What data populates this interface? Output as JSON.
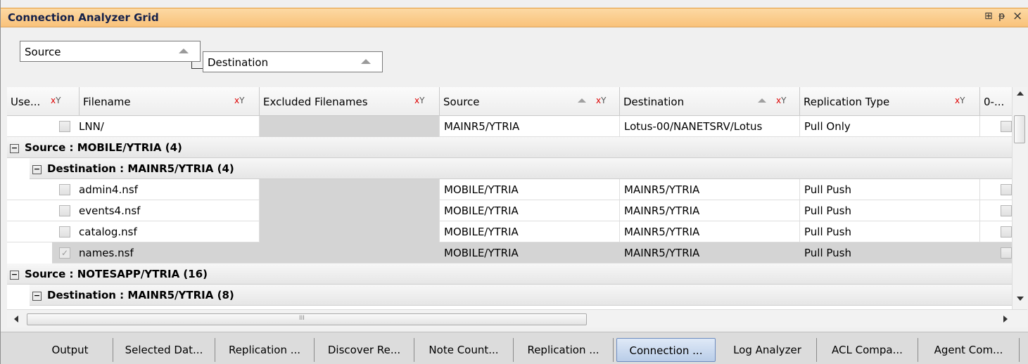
{
  "window": {
    "title": "Connection Analyzer Grid",
    "controls": {
      "pin": "⊞",
      "dock": "ᵽ",
      "close": "×"
    }
  },
  "group_by": {
    "level1": "Source",
    "level2": "Destination"
  },
  "columns": {
    "use": "Use...",
    "filename": "Filename",
    "excluded": "Excluded Filenames",
    "source": "Source",
    "destination": "Destination",
    "replication_type": "Replication Type",
    "extra": "0-..."
  },
  "rows": {
    "top": {
      "filename": "LNN/",
      "source": "MAINR5/YTRIA",
      "destination": "Lotus-00/NANETSRV/Lotus",
      "type": "Pull Only"
    },
    "group1": "Source : MOBILE/YTRIA (4)",
    "group1_sub": "Destination : MAINR5/YTRIA (4)",
    "r1": {
      "filename": "admin4.nsf",
      "source": "MOBILE/YTRIA",
      "destination": "MAINR5/YTRIA",
      "type": "Pull Push"
    },
    "r2": {
      "filename": "events4.nsf",
      "source": "MOBILE/YTRIA",
      "destination": "MAINR5/YTRIA",
      "type": "Pull Push"
    },
    "r3": {
      "filename": "catalog.nsf",
      "source": "MOBILE/YTRIA",
      "destination": "MAINR5/YTRIA",
      "type": "Pull Push"
    },
    "r4": {
      "filename": "names.nsf",
      "source": "MOBILE/YTRIA",
      "destination": "MAINR5/YTRIA",
      "type": "Pull Push"
    },
    "group2": "Source : NOTESAPP/YTRIA (16)",
    "group2_sub": "Destination : MAINR5/YTRIA (8)"
  },
  "scroll": {
    "grip": "III"
  },
  "tabs": {
    "t1": "Output",
    "t2": "Selected Dat...",
    "t3": "Replication ...",
    "t4": "Discover Re...",
    "t5": "Note Count...",
    "t6": "Replication ...",
    "t7": "Connection ...",
    "t8": "Log Analyzer",
    "t9": "ACL Compa...",
    "t10": "Agent Com..."
  },
  "colors": {
    "title_bar": "#f9c27a",
    "active_tab": "#b9cde8",
    "selected_row": "#d4d4d4"
  }
}
